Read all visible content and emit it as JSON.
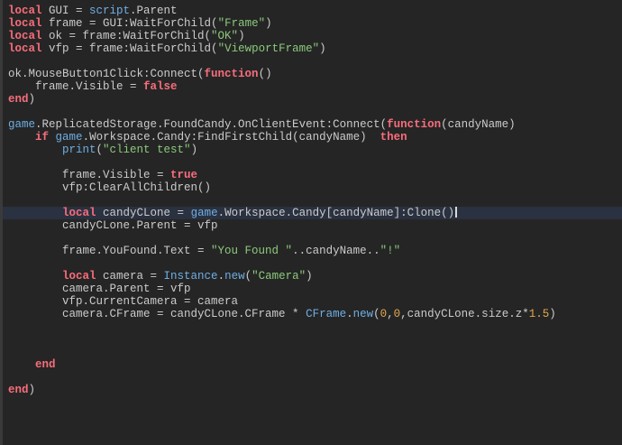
{
  "editor": {
    "language": "lua",
    "background": "#252525",
    "left_strip_color": "#3a3a3a",
    "current_line_color": "#2a3140",
    "caret_color": "#d9d9d9",
    "syntax_colors": {
      "text": "#cbcbcb",
      "keyword": "#f86d7c",
      "builtin": "#6faee3",
      "string": "#8cc97c",
      "number": "#e3a84e"
    },
    "cursor": {
      "line": 17,
      "position": "after Clone()"
    },
    "lines": [
      {
        "tokens": [
          [
            "k",
            "local"
          ],
          [
            "t",
            " GUI = "
          ],
          [
            "b",
            "script"
          ],
          [
            "t",
            ".Parent"
          ]
        ]
      },
      {
        "tokens": [
          [
            "k",
            "local"
          ],
          [
            "t",
            " frame = GUI:WaitForChild("
          ],
          [
            "s",
            "\"Frame\""
          ],
          [
            "t",
            ")"
          ]
        ]
      },
      {
        "tokens": [
          [
            "k",
            "local"
          ],
          [
            "t",
            " ok = frame:WaitForChild("
          ],
          [
            "s",
            "\"OK\""
          ],
          [
            "t",
            ")"
          ]
        ]
      },
      {
        "tokens": [
          [
            "k",
            "local"
          ],
          [
            "t",
            " vfp = frame:WaitForChild("
          ],
          [
            "s",
            "\"ViewportFrame\""
          ],
          [
            "t",
            ")"
          ]
        ]
      },
      {
        "tokens": []
      },
      {
        "tokens": [
          [
            "t",
            "ok.MouseButton1Click:Connect("
          ],
          [
            "k",
            "function"
          ],
          [
            "t",
            "()"
          ]
        ]
      },
      {
        "tokens": [
          [
            "t",
            "    frame.Visible = "
          ],
          [
            "k",
            "false"
          ]
        ]
      },
      {
        "tokens": [
          [
            "k",
            "end"
          ],
          [
            "t",
            ")"
          ]
        ]
      },
      {
        "tokens": []
      },
      {
        "tokens": [
          [
            "b",
            "game"
          ],
          [
            "t",
            ".ReplicatedStorage.FoundCandy.OnClientEvent:Connect("
          ],
          [
            "k",
            "function"
          ],
          [
            "t",
            "(candyName)"
          ]
        ]
      },
      {
        "tokens": [
          [
            "t",
            "    "
          ],
          [
            "k",
            "if"
          ],
          [
            "t",
            " "
          ],
          [
            "b",
            "game"
          ],
          [
            "t",
            ".Workspace.Candy:FindFirstChild(candyName)  "
          ],
          [
            "k",
            "then"
          ]
        ]
      },
      {
        "tokens": [
          [
            "t",
            "        "
          ],
          [
            "b",
            "print"
          ],
          [
            "t",
            "("
          ],
          [
            "s",
            "\"client test\""
          ],
          [
            "t",
            ")"
          ]
        ]
      },
      {
        "tokens": []
      },
      {
        "tokens": [
          [
            "t",
            "        frame.Visible = "
          ],
          [
            "k",
            "true"
          ]
        ]
      },
      {
        "tokens": [
          [
            "t",
            "        vfp:ClearAllChildren()"
          ]
        ]
      },
      {
        "tokens": []
      },
      {
        "current": true,
        "caret": true,
        "tokens": [
          [
            "t",
            "        "
          ],
          [
            "k",
            "local"
          ],
          [
            "t",
            " candyCLone = "
          ],
          [
            "b",
            "game"
          ],
          [
            "t",
            ".Workspace.Candy[candyName]:Clone()"
          ]
        ]
      },
      {
        "tokens": [
          [
            "t",
            "        candyCLone.Parent = vfp"
          ]
        ]
      },
      {
        "tokens": []
      },
      {
        "tokens": [
          [
            "t",
            "        frame.YouFound.Text = "
          ],
          [
            "s",
            "\"You Found \""
          ],
          [
            "t",
            "..candyName.."
          ],
          [
            "s",
            "\"!\""
          ]
        ]
      },
      {
        "tokens": []
      },
      {
        "tokens": [
          [
            "t",
            "        "
          ],
          [
            "k",
            "local"
          ],
          [
            "t",
            " camera = "
          ],
          [
            "b",
            "Instance"
          ],
          [
            "t",
            "."
          ],
          [
            "b",
            "new"
          ],
          [
            "t",
            "("
          ],
          [
            "s",
            "\"Camera\""
          ],
          [
            "t",
            ")"
          ]
        ]
      },
      {
        "tokens": [
          [
            "t",
            "        camera.Parent = vfp"
          ]
        ]
      },
      {
        "tokens": [
          [
            "t",
            "        vfp.CurrentCamera = camera"
          ]
        ]
      },
      {
        "tokens": [
          [
            "t",
            "        camera.CFrame = candyCLone.CFrame * "
          ],
          [
            "b",
            "CFrame"
          ],
          [
            "t",
            "."
          ],
          [
            "b",
            "new"
          ],
          [
            "t",
            "("
          ],
          [
            "n",
            "0"
          ],
          [
            "t",
            ","
          ],
          [
            "n",
            "0"
          ],
          [
            "t",
            ",candyCLone.size.z*"
          ],
          [
            "n",
            "1.5"
          ],
          [
            "t",
            ")"
          ]
        ]
      },
      {
        "tokens": []
      },
      {
        "tokens": []
      },
      {
        "tokens": []
      },
      {
        "tokens": [
          [
            "t",
            "    "
          ],
          [
            "k",
            "end"
          ]
        ]
      },
      {
        "tokens": []
      },
      {
        "tokens": [
          [
            "k",
            "end"
          ],
          [
            "t",
            ")"
          ]
        ]
      }
    ]
  }
}
